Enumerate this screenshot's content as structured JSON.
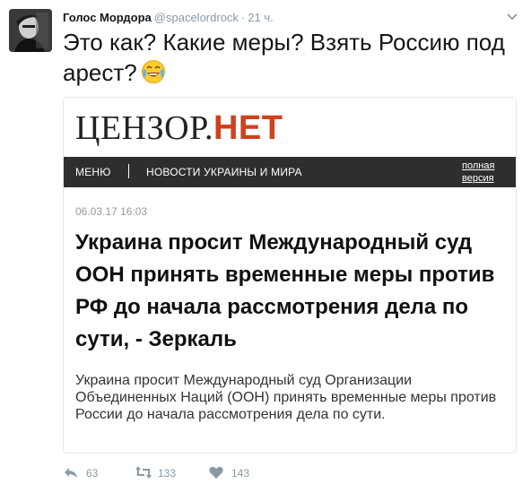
{
  "tweet": {
    "author_name": "Голос Мордора",
    "handle": "@spacelordrock",
    "separator": "·",
    "time": "21 ч.",
    "text": "Это как? Какие меры? Взять Россию под арест?"
  },
  "card": {
    "logo_part1": "ЦЕНЗОР.",
    "logo_part2": "НЕТ",
    "nav_menu": "МЕНЮ",
    "nav_news": "НОВОСТИ УКРАИНЫ И МИРА",
    "nav_full_line1": "полная",
    "nav_full_line2": "версия",
    "date": "06.03.17 16:03",
    "headline": "Украина просит Международный суд ООН принять временные меры против РФ до начала рассмотрения дела по сути, - Зеркаль",
    "summary": "Украина просит Международный суд Организации Объединенных Наций (ООН) принять временные меры против России до начала рассмотрения дела по сути."
  },
  "actions": {
    "reply_count": "63",
    "retweet_count": "133",
    "like_count": "143"
  },
  "icons": {
    "caret": "chevron-down-icon",
    "reply": "reply-icon",
    "retweet": "retweet-icon",
    "like": "heart-icon",
    "emoji": "face-with-tears-of-joy-icon"
  },
  "colors": {
    "logo_accent": "#d0411c",
    "navbar_bg": "#2e2e2e",
    "meta_gray": "#8899a6"
  }
}
